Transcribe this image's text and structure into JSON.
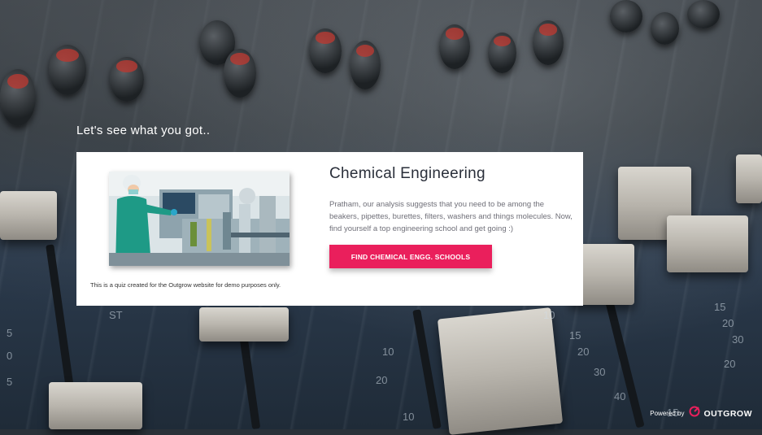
{
  "heading": "Let's see what you got..",
  "result": {
    "title": "Chemical Engineering",
    "description": "Pratham, our analysis suggests that you need to be among the beakers, pipettes, burettes, filters, washers and things molecules. Now, find yourself a top engineering school and get going :)",
    "cta_label": "FIND CHEMICAL ENGG. SCHOOLS",
    "image_icon": "lab-technician-photo",
    "disclaimer": "This is a quiz created for the Outgrow website for demo purposes only."
  },
  "footer": {
    "powered_by": "Powered by",
    "brand": "OUTGROW",
    "logo_icon": "outgrow-logo-icon"
  },
  "background_scale_labels": [
    "ST",
    "5",
    "0",
    "5",
    "10",
    "20",
    "10",
    "15",
    "20",
    "30",
    "40",
    "15",
    "20",
    "30",
    "10",
    "15",
    "20"
  ],
  "colors": {
    "accent": "#ea1f5c",
    "title": "#2a2f3a",
    "text": "#6f6f78"
  }
}
